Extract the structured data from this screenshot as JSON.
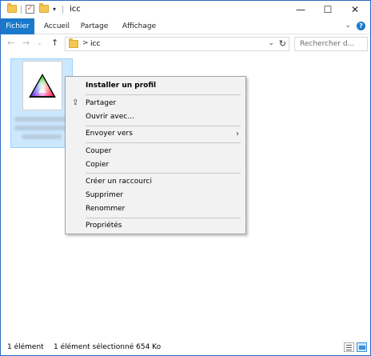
{
  "window": {
    "title": "icc",
    "controls": {
      "minimize": "—",
      "maximize": "☐",
      "close": "✕"
    }
  },
  "ribbon": {
    "tabs": [
      "Fichier",
      "Accueil",
      "Partage",
      "Affichage"
    ]
  },
  "address_bar": {
    "path_separator": ">",
    "path": "icc"
  },
  "search": {
    "placeholder": "Rechercher d..."
  },
  "file_view": {
    "selected_file": {
      "icon": "icc-profile-icon",
      "label_blurred": true
    }
  },
  "context_menu": {
    "items": [
      {
        "label": "Installer un profil",
        "bold": true
      },
      {
        "label": "Partager",
        "icon": "share-icon"
      },
      {
        "label": "Ouvrir avec..."
      },
      {
        "label": "Envoyer vers",
        "submenu": true
      },
      {
        "label": "Couper"
      },
      {
        "label": "Copier"
      },
      {
        "label": "Créer un raccourci"
      },
      {
        "label": "Supprimer"
      },
      {
        "label": "Renommer"
      },
      {
        "label": "Propriétés"
      }
    ]
  },
  "status_bar": {
    "item_count": "1 élément",
    "selection": "1 élément sélectionné  654 Ko"
  },
  "colors": {
    "accent": "#1979ca",
    "selection_bg": "#cce8ff",
    "menu_bg": "#f2f2f2"
  }
}
